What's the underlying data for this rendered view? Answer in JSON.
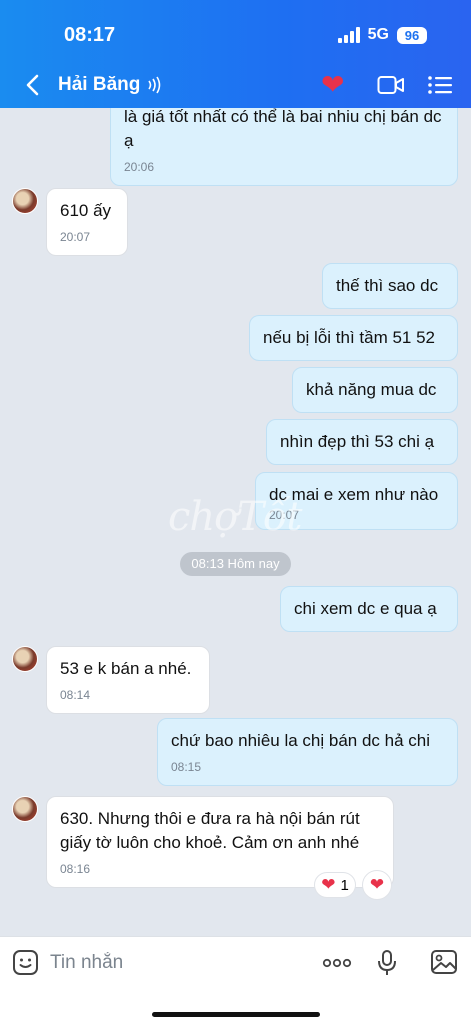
{
  "status": {
    "time": "08:17",
    "network": "5G",
    "battery": "96"
  },
  "header": {
    "contact_name": "Hải Băng"
  },
  "watermark": "chợTốt",
  "messages": [
    {
      "dir": "out",
      "text": "là giá tốt nhất có thể là bai nhiu chị bán dc ạ",
      "time": "20:06"
    },
    {
      "dir": "in",
      "text": "610 ấy",
      "time": "20:07"
    },
    {
      "dir": "out",
      "text": "thế thì sao dc"
    },
    {
      "dir": "out",
      "text": "nếu bị lỗi thì tầm 51 52"
    },
    {
      "dir": "out",
      "text": "khả năng mua dc"
    },
    {
      "dir": "out",
      "text": "nhìn đẹp thì 53 chi ạ"
    },
    {
      "dir": "out",
      "text": "dc mai e xem như nào",
      "time": "20:07"
    },
    {
      "dir": "out",
      "text": "chi xem dc e qua ạ"
    },
    {
      "dir": "in",
      "text": "53 e k bán a nhé.",
      "time": "08:14"
    },
    {
      "dir": "out",
      "text": "chứ bao nhiêu la chị bán dc hả chi",
      "time": "08:15"
    },
    {
      "dir": "in",
      "text": "630. Nhưng thôi e đưa ra hà nội bán rút giấy tờ luôn cho khoẻ. Cảm ơn anh nhé",
      "time": "08:16"
    }
  ],
  "date_separator": "08:13 Hôm nay",
  "reaction": {
    "count": "1"
  },
  "composer": {
    "placeholder": "Tin nhắn"
  },
  "colors": {
    "header": "#1e6ff2",
    "out_bubble": "#dbf1fd",
    "in_bubble": "#ffffff",
    "heart": "#e8324a"
  }
}
